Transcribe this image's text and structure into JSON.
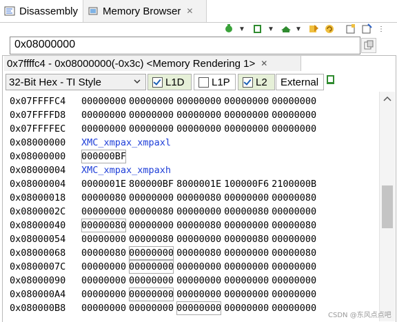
{
  "tabs": {
    "disassembly": "Disassembly",
    "memory_browser": "Memory Browser"
  },
  "address_input": {
    "value": "0x08000000"
  },
  "rendering_tab": {
    "label": "0x7ffffc4 - 0x08000000(-0x3c) <Memory Rendering 1>"
  },
  "format_select": {
    "value": "32-Bit Hex - TI Style"
  },
  "cache_toggles": [
    {
      "label": "L1D",
      "checked": true
    },
    {
      "label": "L1P",
      "checked": false
    },
    {
      "label": "L2",
      "checked": true
    }
  ],
  "external_label": "External",
  "rows": [
    {
      "addr": "0x07FFFFC4",
      "cells": [
        "00000000",
        "00000000",
        "00000000",
        "00000000",
        "00000000"
      ]
    },
    {
      "addr": "0x07FFFFD8",
      "cells": [
        "00000000",
        "00000000",
        "00000000",
        "00000000",
        "00000000"
      ]
    },
    {
      "addr": "0x07FFFFEC",
      "cells": [
        "00000000",
        "00000000",
        "00000000",
        "00000000",
        "00000000"
      ]
    },
    {
      "addr": "0x08000000",
      "label": "XMC_xmpax_xmpaxl"
    },
    {
      "addr": "0x08000000",
      "cells": [
        "000000BF"
      ]
    },
    {
      "addr": "0x08000004",
      "label": "XMC_xmpax_xmpaxh"
    },
    {
      "addr": "0x08000004",
      "cells": [
        "0000001E",
        "800000BF",
        "8000001E",
        "100000F6",
        "2100000B"
      ]
    },
    {
      "addr": "0x08000018",
      "cells": [
        "00000080",
        "00000000",
        "00000080",
        "00000000",
        "00000080"
      ]
    },
    {
      "addr": "0x0800002C",
      "cells": [
        "00000000",
        "00000080",
        "00000000",
        "00000080",
        "00000000"
      ]
    },
    {
      "addr": "0x08000040",
      "cells": [
        "00000080",
        "00000000",
        "00000080",
        "00000000",
        "00000080"
      ]
    },
    {
      "addr": "0x08000054",
      "cells": [
        "00000000",
        "00000080",
        "00000000",
        "00000080",
        "00000000"
      ]
    },
    {
      "addr": "0x08000068",
      "cells": [
        "00000080",
        "00000000",
        "00000080",
        "00000000",
        "00000080"
      ]
    },
    {
      "addr": "0x0800007C",
      "cells": [
        "00000000",
        "00000000",
        "00000000",
        "00000000",
        "00000000"
      ]
    },
    {
      "addr": "0x08000090",
      "cells": [
        "00000000",
        "00000000",
        "00000000",
        "00000000",
        "00000000"
      ]
    },
    {
      "addr": "0x080000A4",
      "cells": [
        "00000000",
        "00000000",
        "00000000",
        "00000000",
        "00000000"
      ]
    },
    {
      "addr": "0x080000B8",
      "cells": [
        "00000000",
        "00000000",
        "00000000",
        "00000000",
        "00000000"
      ]
    }
  ],
  "watermark": "CSDN @东风点点吧",
  "colors": {
    "label_blue": "#1f3fd8",
    "toggle_on_bg": "#e6f0d8",
    "scroll_thumb": "#c4c4c4"
  }
}
